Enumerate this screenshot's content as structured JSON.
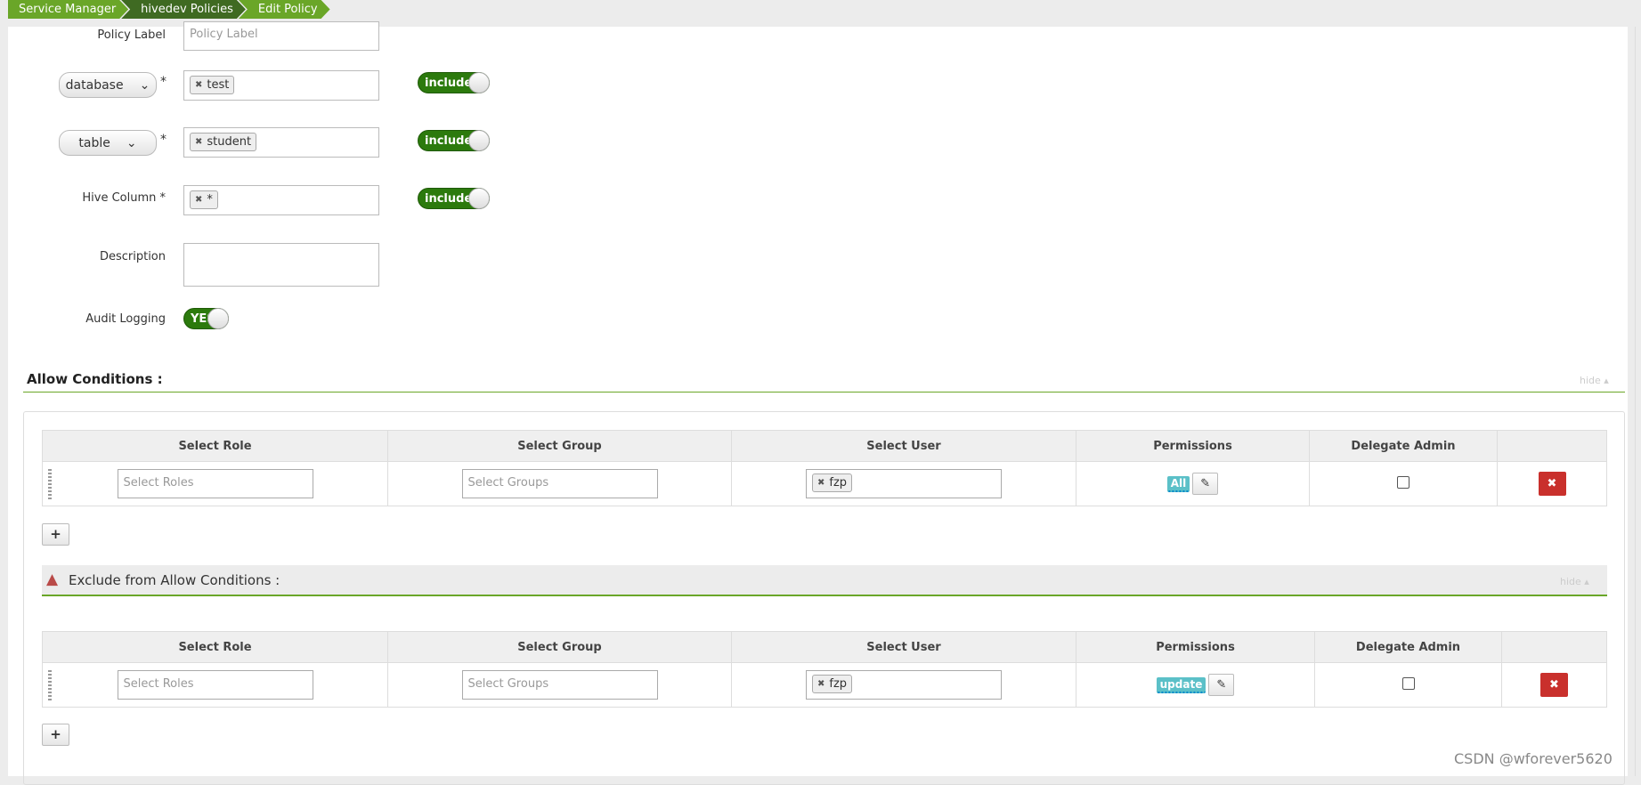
{
  "breadcrumb": [
    "Service Manager",
    "hivedev Policies",
    "Edit Policy"
  ],
  "form": {
    "policy_label": {
      "label": "Policy Label",
      "placeholder": "Policy Label"
    },
    "resources": [
      {
        "type": "database",
        "values": [
          "test"
        ],
        "toggle": "include"
      },
      {
        "type": "table",
        "values": [
          "student"
        ],
        "toggle": "include"
      },
      {
        "label": "Hive Column *",
        "values": [
          "*"
        ],
        "toggle": "include"
      }
    ],
    "description_label": "Description",
    "audit_label": "Audit Logging",
    "audit_toggle": "YES"
  },
  "allow": {
    "title": "Allow Conditions :",
    "hide": "hide",
    "headers": [
      "Select Role",
      "Select Group",
      "Select User",
      "Permissions",
      "Delegate Admin"
    ],
    "row": {
      "role_placeholder": "Select Roles",
      "group_placeholder": "Select Groups",
      "user": "fzp",
      "permission": "All",
      "delegate_admin": false
    }
  },
  "exclude": {
    "title": "Exclude from Allow Conditions :",
    "hide": "hide",
    "headers": [
      "Select Role",
      "Select Group",
      "Select User",
      "Permissions",
      "Delegate Admin"
    ],
    "row": {
      "role_placeholder": "Select Roles",
      "group_placeholder": "Select Groups",
      "user": "fzp",
      "permission": "update",
      "delegate_admin": false
    }
  },
  "watermark": "CSDN @wforever5620",
  "colors": {
    "brand_green": "#6aa628",
    "toggle_green": "#2c7a0d",
    "delete_red": "#c9302c",
    "permission_tag": "#5bc0c8"
  }
}
